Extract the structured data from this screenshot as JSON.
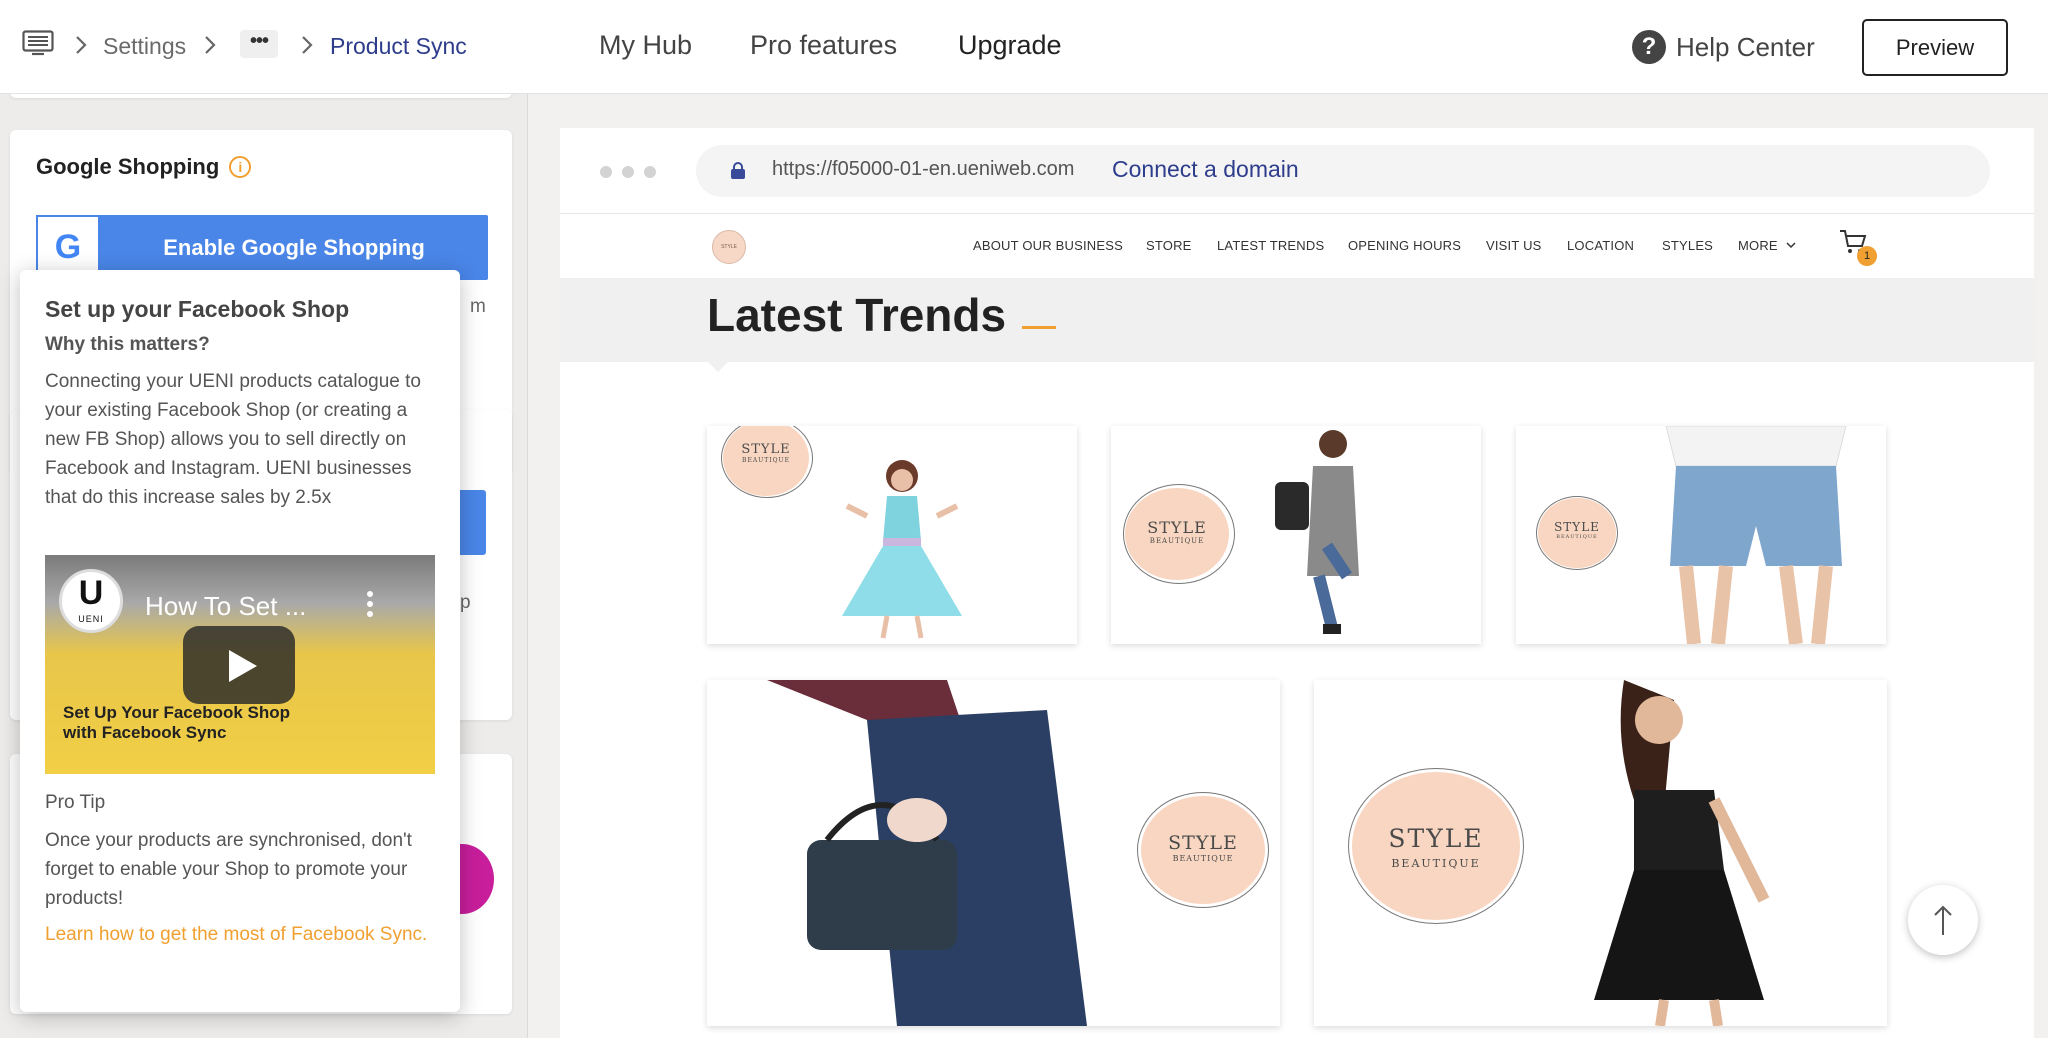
{
  "topbar": {
    "breadcrumb": {
      "settings": "Settings",
      "ellipsis": "•••",
      "current": "Product Sync"
    },
    "nav": {
      "my_hub": "My Hub",
      "pro_features": "Pro features",
      "upgrade": "Upgrade"
    },
    "help_center": "Help Center",
    "help_glyph": "?",
    "preview": "Preview"
  },
  "left_panel": {
    "google_shopping": {
      "title": "Google Shopping",
      "info_glyph": "i",
      "button_label": "Enable Google Shopping",
      "g_logo": "G",
      "partial_text_1": "m",
      "partial_text_2": "p"
    }
  },
  "popover": {
    "title": "Set up your Facebook Shop",
    "subtitle": "Why this matters?",
    "body": "Connecting your UENI products catalogue to your existing Facebook Shop (or creating a new FB Shop) allows you to sell directly on Facebook and Instagram. UENI businesses that do this increase sales by 2.5x",
    "video": {
      "logo_letter": "U",
      "logo_text": "UENI",
      "title": "How To Set ...",
      "caption_line1": "Set Up Your Facebook Shop",
      "caption_line2": "with Facebook Sync"
    },
    "pro_tip_heading": "Pro Tip",
    "pro_tip_body": "Once your products are synchronised, don't forget to enable your Shop to promote your products!",
    "link": "Learn how to get the most of Facebook Sync."
  },
  "browser": {
    "url": "https://f05000-01-en.ueniweb.com",
    "connect_domain": "Connect a domain"
  },
  "site": {
    "logo_text": "STYLE",
    "nav": [
      "ABOUT OUR BUSINESS",
      "STORE",
      "LATEST TRENDS",
      "OPENING HOURS",
      "VISIT US",
      "LOCATION",
      "STYLES",
      "MORE"
    ],
    "cart_count": "1",
    "section_title": "Latest Trends",
    "stamp_word": "STYLE",
    "stamp_sub": "BEAUTIQUE"
  },
  "colors": {
    "accent_orange": "#f0a030",
    "link_blue": "#2d3d8c",
    "google_blue": "#4a86e8",
    "stamp_peach": "#f8d6c1"
  },
  "icons": {
    "toggle_sidebar": "monitor-icon",
    "chevron": "chevron-right-icon",
    "help": "question-circle-icon",
    "lock": "lock-icon",
    "cart": "cart-icon",
    "play": "play-icon",
    "scroll_top": "arrow-up-icon"
  }
}
